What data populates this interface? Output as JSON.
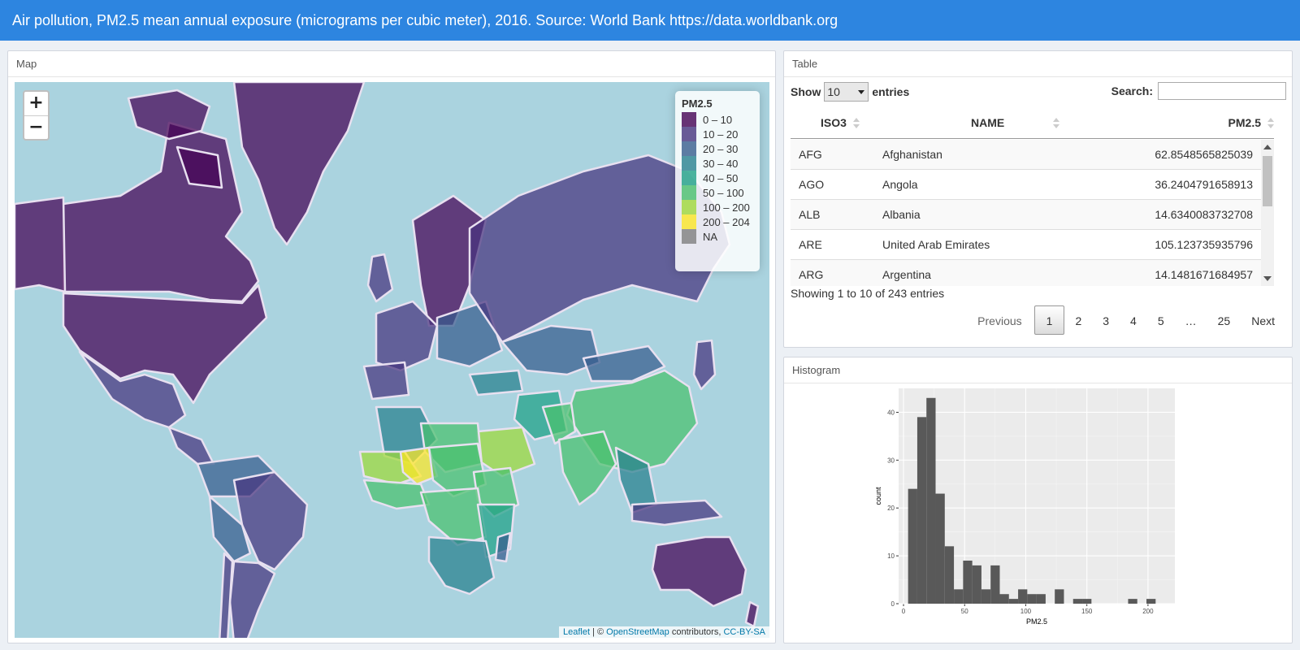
{
  "header": {
    "title": "Air pollution, PM2.5 mean annual exposure (micrograms per cubic meter), 2016. Source: World Bank https://data.worldbank.org"
  },
  "map": {
    "box_title": "Map",
    "zoom_in": "+",
    "zoom_out": "−",
    "legend": {
      "title": "PM2.5",
      "items": [
        {
          "label": "0 – 10",
          "color": "#440154"
        },
        {
          "label": "10 – 20",
          "color": "#46337e"
        },
        {
          "label": "20 – 30",
          "color": "#365c8d"
        },
        {
          "label": "30 – 40",
          "color": "#277f8e"
        },
        {
          "label": "40 – 50",
          "color": "#1fa187"
        },
        {
          "label": "50 – 100",
          "color": "#4ac16d"
        },
        {
          "label": "100 – 200",
          "color": "#a0da39"
        },
        {
          "label": "200 – 204",
          "color": "#fde725"
        },
        {
          "label": "NA",
          "color": "#808080"
        }
      ]
    },
    "attribution": {
      "leaflet": "Leaflet",
      "sep": " | © ",
      "osm": "OpenStreetMap",
      "contrib": " contributors, ",
      "license": "CC-BY-SA"
    }
  },
  "table": {
    "box_title": "Table",
    "show_label": "Show",
    "entries_value": "10",
    "entries_label": "entries",
    "search_label": "Search:",
    "search_value": "",
    "columns": [
      "ISO3",
      "NAME",
      "PM2.5"
    ],
    "rows": [
      {
        "iso3": "AFG",
        "name": "Afghanistan",
        "pm25": "62.8548565825039"
      },
      {
        "iso3": "AGO",
        "name": "Angola",
        "pm25": "36.2404791658913"
      },
      {
        "iso3": "ALB",
        "name": "Albania",
        "pm25": "14.6340083732708"
      },
      {
        "iso3": "ARE",
        "name": "United Arab Emirates",
        "pm25": "105.123735935796"
      },
      {
        "iso3": "ARG",
        "name": "Argentina",
        "pm25": "14.1481671684957"
      }
    ],
    "info": "Showing 1 to 10 of 243 entries",
    "pagination": [
      "Previous",
      "1",
      "2",
      "3",
      "4",
      "5",
      "…",
      "25",
      "Next"
    ],
    "current_page": "1"
  },
  "histogram": {
    "box_title": "Histogram",
    "chart_data": {
      "type": "bar",
      "xlabel": "PM2.5",
      "ylabel": "count",
      "xlim": [
        -4,
        222
      ],
      "ylim": [
        0,
        45
      ],
      "x_ticks": [
        0,
        50,
        100,
        150,
        200
      ],
      "y_ticks": [
        0,
        10,
        20,
        30,
        40
      ],
      "bin_width": 7.5,
      "bin_starts": [
        3.75,
        11.25,
        18.75,
        26.25,
        33.75,
        41.25,
        48.75,
        56.25,
        63.75,
        71.25,
        78.75,
        86.25,
        93.75,
        101.25,
        108.75,
        116.25,
        123.75,
        131.25,
        138.75,
        146.25,
        153.75,
        161.25,
        168.75,
        176.25,
        183.75,
        191.25,
        198.75,
        206.25
      ],
      "values": [
        24,
        39,
        43,
        23,
        12,
        3,
        9,
        8,
        3,
        8,
        2,
        1,
        3,
        2,
        2,
        0,
        3,
        0,
        1,
        1,
        0,
        0,
        0,
        0,
        1,
        0,
        1,
        0
      ],
      "grid": true
    }
  }
}
